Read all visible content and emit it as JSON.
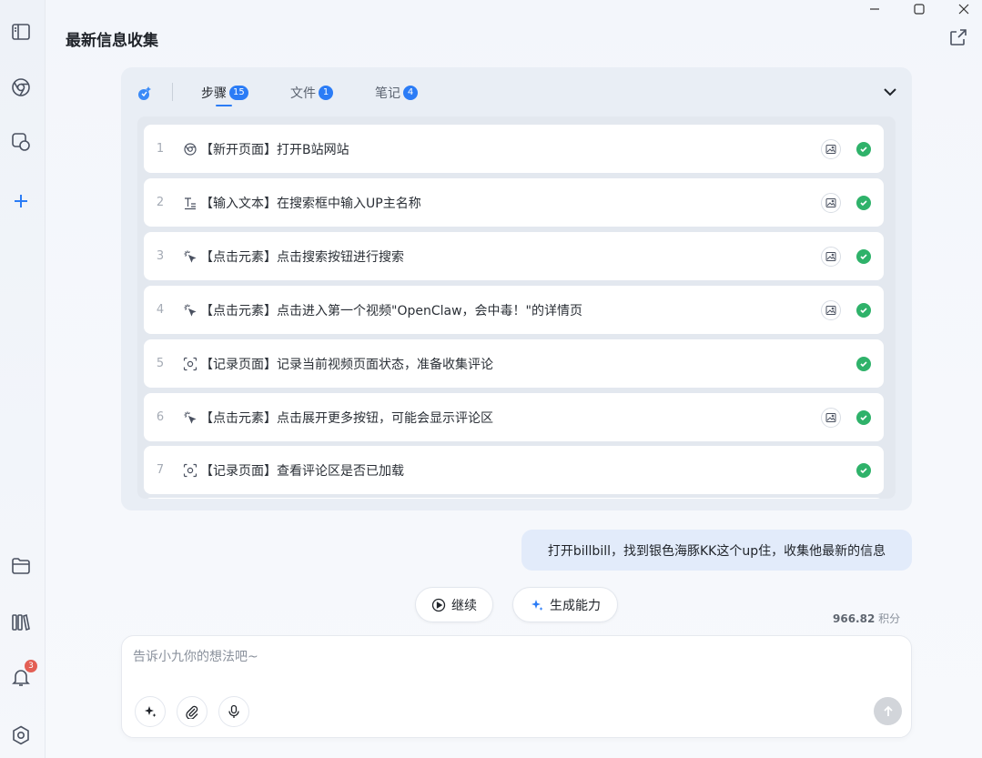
{
  "window": {
    "title": "最新信息收集"
  },
  "sidebar": {
    "notifications_badge": "3"
  },
  "panel": {
    "tabs": [
      {
        "label": "步骤",
        "count": "15"
      },
      {
        "label": "文件",
        "count": "1"
      },
      {
        "label": "笔记",
        "count": "4"
      }
    ],
    "steps": [
      {
        "num": "1",
        "text": "【新开页面】打开B站网站",
        "icon": "browser-icon",
        "has_screenshot": true
      },
      {
        "num": "2",
        "text": "【输入文本】在搜索框中输入UP主名称",
        "icon": "text-input-icon",
        "has_screenshot": true
      },
      {
        "num": "3",
        "text": "【点击元素】点击搜索按钮进行搜索",
        "icon": "click-icon",
        "has_screenshot": true
      },
      {
        "num": "4",
        "text": "【点击元素】点击进入第一个视频\"OpenClaw，会中毒！\"的详情页",
        "icon": "click-icon",
        "has_screenshot": true
      },
      {
        "num": "5",
        "text": "【记录页面】记录当前视频页面状态，准备收集评论",
        "icon": "record-icon",
        "has_screenshot": false
      },
      {
        "num": "6",
        "text": "【点击元素】点击展开更多按钮，可能会显示评论区",
        "icon": "click-icon",
        "has_screenshot": true
      },
      {
        "num": "7",
        "text": "【记录页面】查看评论区是否已加载",
        "icon": "record-icon",
        "has_screenshot": false
      }
    ]
  },
  "chat": {
    "user_message": "打开billbill，找到银色海豚KK这个up住，收集他最新的信息"
  },
  "actions": {
    "continue_label": "继续",
    "generate_label": "生成能力"
  },
  "points": {
    "value": "966.82",
    "unit": "积分"
  },
  "composer": {
    "placeholder": "告诉小九你的想法吧~"
  },
  "colors": {
    "accent": "#2b7cf6",
    "success": "#2fb26a",
    "bubble": "#e2ebfa",
    "badge": "#e35f55"
  }
}
